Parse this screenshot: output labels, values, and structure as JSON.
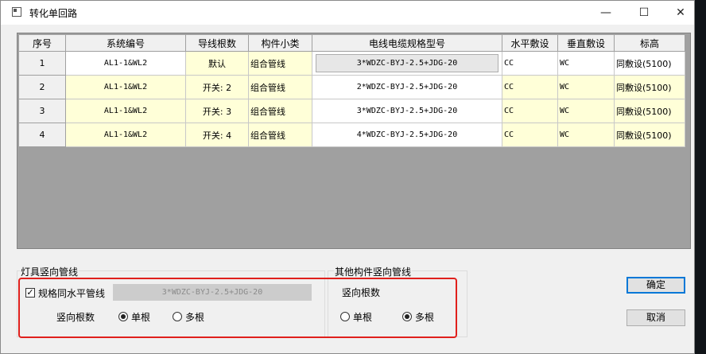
{
  "window": {
    "title": "转化单回路",
    "min_glyph": "—",
    "max_glyph": "☐",
    "close_glyph": "✕"
  },
  "table": {
    "headers": [
      "序号",
      "系统编号",
      "导线根数",
      "构件小类",
      "电线电缆规格型号",
      "水平敷设",
      "垂直敷设",
      "标高"
    ],
    "rows": [
      {
        "no": "1",
        "sys": "AL1-1&WL2",
        "count": "默认",
        "type": "组合管线",
        "spec": "3*WDZC-BYJ-2.5+JDG-20",
        "horiz": "CC",
        "vert": "WC",
        "elev": "同敷设(5100)"
      },
      {
        "no": "2",
        "sys": "AL1-1&WL2",
        "count": "开关: 2",
        "type": "组合管线",
        "spec": "2*WDZC-BYJ-2.5+JDG-20",
        "horiz": "CC",
        "vert": "WC",
        "elev": "同敷设(5100)"
      },
      {
        "no": "3",
        "sys": "AL1-1&WL2",
        "count": "开关: 3",
        "type": "组合管线",
        "spec": "3*WDZC-BYJ-2.5+JDG-20",
        "horiz": "CC",
        "vert": "WC",
        "elev": "同敷设(5100)"
      },
      {
        "no": "4",
        "sys": "AL1-1&WL2",
        "count": "开关: 4",
        "type": "组合管线",
        "spec": "4*WDZC-BYJ-2.5+JDG-20",
        "horiz": "CC",
        "vert": "WC",
        "elev": "同敷设(5100)"
      }
    ]
  },
  "lamp_group": {
    "title": "灯具竖向管线",
    "same_spec_label": "规格同水平管线",
    "same_spec_checked": true,
    "spec_value": "3*WDZC-BYJ-2.5+JDG-20",
    "vertical_count_label": "竖向根数",
    "single_label": "单根",
    "multi_label": "多根",
    "selected": "单根"
  },
  "other_group": {
    "title": "其他构件竖向管线",
    "vertical_count_label": "竖向根数",
    "single_label": "单根",
    "multi_label": "多根",
    "selected": "多根"
  },
  "buttons": {
    "ok": "确定",
    "cancel": "取消"
  },
  "colors": {
    "highlight": "#ffffd8",
    "annotation": "#e0201c",
    "grid_bg": "#a0a0a0"
  }
}
